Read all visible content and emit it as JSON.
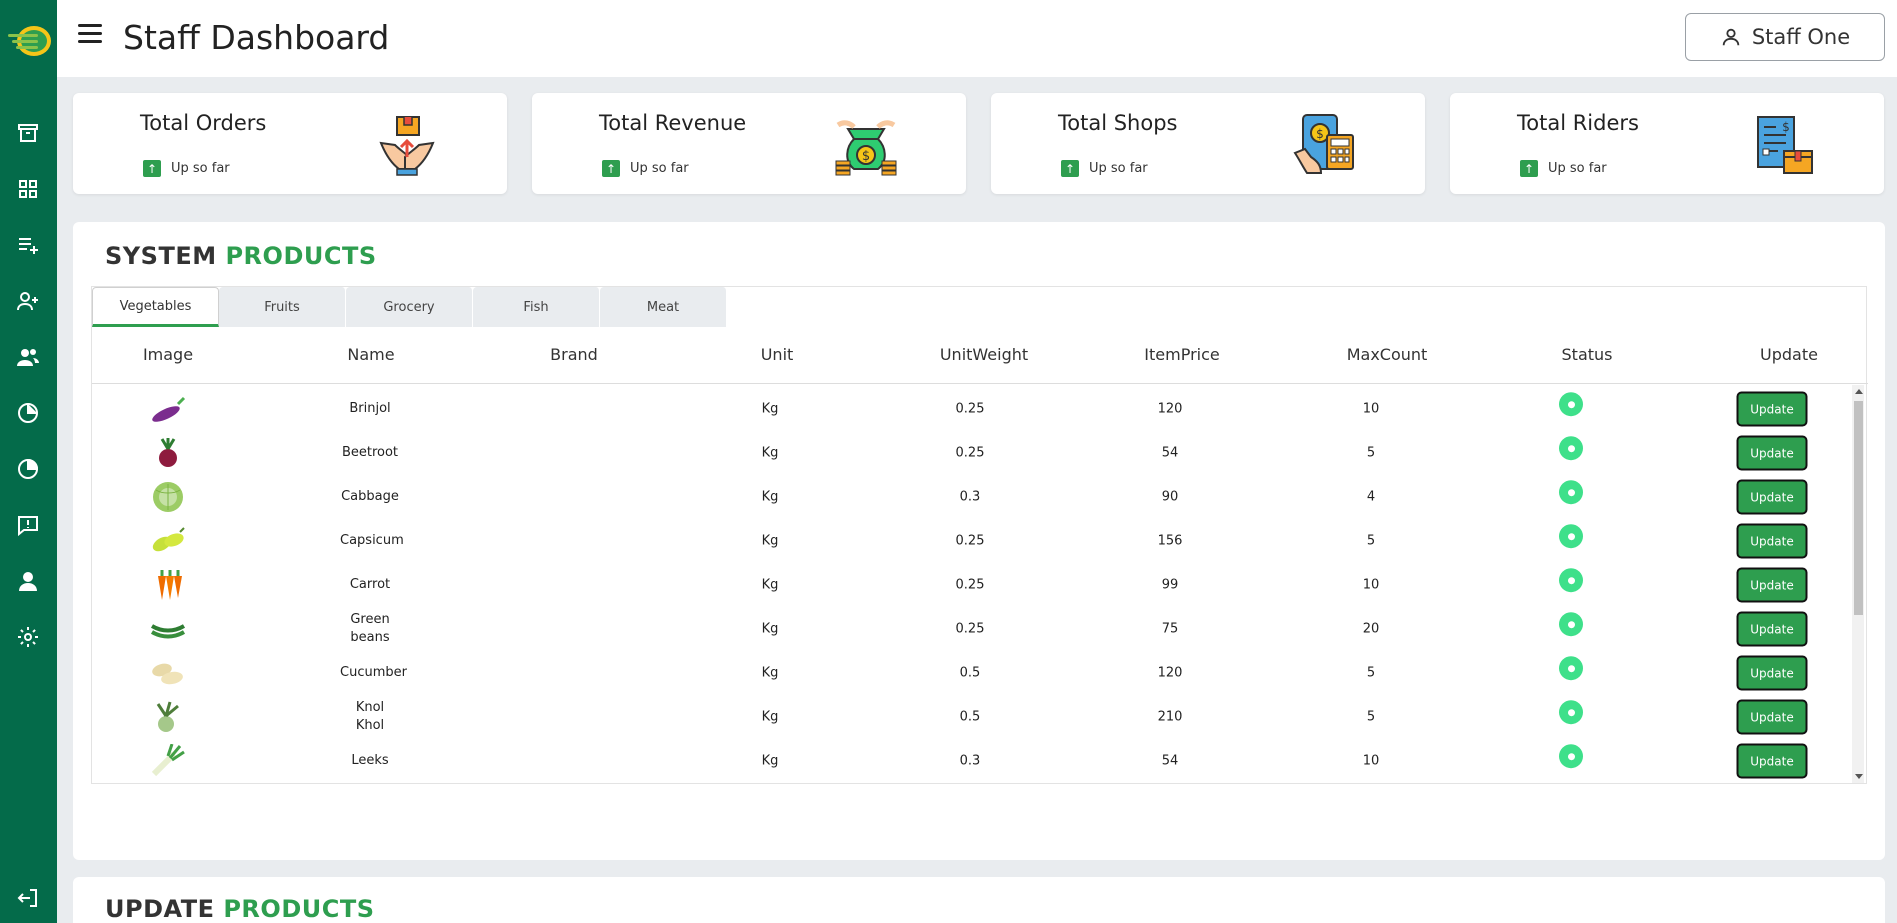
{
  "header": {
    "title": "Staff Dashboard",
    "user_name": "Staff One"
  },
  "cards": [
    {
      "title": "Total Orders",
      "subtitle": "Up so far"
    },
    {
      "title": "Total Revenue",
      "subtitle": "Up so far"
    },
    {
      "title": "Total Shops",
      "subtitle": "Up so far"
    },
    {
      "title": "Total Riders",
      "subtitle": "Up so far"
    }
  ],
  "system_products": {
    "title_part1": "SYSTEM",
    "title_part2": "PRODUCTS",
    "tabs": [
      "Vegetables",
      "Fruits",
      "Grocery",
      "Fish",
      "Meat"
    ],
    "active_tab": "Vegetables",
    "columns": [
      "Image",
      "Name",
      "Brand",
      "Unit",
      "UnitWeight",
      "ItemPrice",
      "MaxCount",
      "Status",
      "Update"
    ],
    "update_label": "Update",
    "rows": [
      {
        "name": "Brinjol",
        "brand": "",
        "unit": "Kg",
        "unit_weight": "0.25",
        "price": "120",
        "max_count": "10",
        "status": "active"
      },
      {
        "name": "Beetroot",
        "brand": "",
        "unit": "Kg",
        "unit_weight": "0.25",
        "price": "54",
        "max_count": "5",
        "status": "active"
      },
      {
        "name": "Cabbage",
        "brand": "",
        "unit": "Kg",
        "unit_weight": "0.3",
        "price": "90",
        "max_count": "4",
        "status": "active"
      },
      {
        "name": "Capsicum",
        "brand": "",
        "unit": "Kg",
        "unit_weight": "0.25",
        "price": "156",
        "max_count": "5",
        "status": "active"
      },
      {
        "name": "Carrot",
        "brand": "",
        "unit": "Kg",
        "unit_weight": "0.25",
        "price": "99",
        "max_count": "10",
        "status": "active"
      },
      {
        "name": "Green beans",
        "brand": "",
        "unit": "Kg",
        "unit_weight": "0.25",
        "price": "75",
        "max_count": "20",
        "status": "active"
      },
      {
        "name": "Cucumber",
        "brand": "",
        "unit": "Kg",
        "unit_weight": "0.5",
        "price": "120",
        "max_count": "5",
        "status": "active"
      },
      {
        "name": "Knol Khol",
        "brand": "",
        "unit": "Kg",
        "unit_weight": "0.5",
        "price": "210",
        "max_count": "5",
        "status": "active"
      },
      {
        "name": "Leeks",
        "brand": "",
        "unit": "Kg",
        "unit_weight": "0.3",
        "price": "54",
        "max_count": "10",
        "status": "active"
      }
    ]
  },
  "update_products": {
    "title_part1": "UPDATE",
    "title_part2": "PRODUCTS"
  },
  "colors": {
    "sidebar": "#046b4a",
    "accent_green": "#2e9e4f",
    "status_active": "#3ee08a"
  },
  "icons": {
    "sidebar": [
      "logo",
      "orders-icon",
      "dashboard-icon",
      "add-list-icon",
      "add-user-icon",
      "users-icon",
      "pie-chart-icon",
      "pie-chart-alt-icon",
      "feedback-icon",
      "profile-icon",
      "settings-icon",
      "logout-icon"
    ]
  }
}
